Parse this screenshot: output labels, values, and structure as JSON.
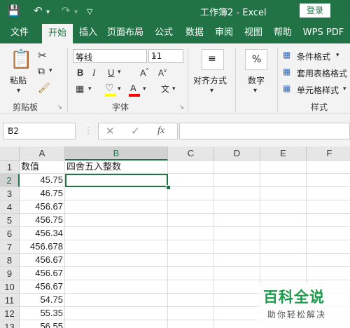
{
  "app": {
    "title": "工作簿2  -  Excel",
    "signin_label": "登录",
    "accent": "#217346"
  },
  "quick_access": {
    "save_icon": "save-icon",
    "undo_icon": "undo-icon",
    "redo_icon": "redo-icon",
    "customize_icon": "customize-icon"
  },
  "tabs": [
    "文件",
    "开始",
    "插入",
    "页面布局",
    "公式",
    "数据",
    "审阅",
    "视图",
    "帮助",
    "WPS PDF"
  ],
  "ribbon": {
    "clipboard": {
      "paste_label": "粘贴",
      "group_label": "剪贴板"
    },
    "font": {
      "font_name": "等线",
      "font_size": "11",
      "group_label": "字体"
    },
    "alignment": {
      "label": "对齐方式"
    },
    "number": {
      "label": "数字",
      "icon_text": "%"
    },
    "styles": {
      "conditional_format": "条件格式",
      "table_format": "套用表格格式",
      "cell_style": "单元格样式",
      "group_label": "样式"
    }
  },
  "formula_bar": {
    "name_box": "B2",
    "fx_label": "fx",
    "formula": ""
  },
  "sheet": {
    "columns": [
      "A",
      "B",
      "C",
      "D",
      "E",
      "F"
    ],
    "selected_col": "B",
    "selected_row": "2",
    "rows": [
      {
        "num": "1",
        "a": "数值",
        "b": "四舍五入整数"
      },
      {
        "num": "2",
        "a": "45.75",
        "b": ""
      },
      {
        "num": "3",
        "a": "46.75",
        "b": ""
      },
      {
        "num": "4",
        "a": "456.67",
        "b": ""
      },
      {
        "num": "5",
        "a": "456.75",
        "b": ""
      },
      {
        "num": "6",
        "a": "456.34",
        "b": ""
      },
      {
        "num": "7",
        "a": "456.678",
        "b": ""
      },
      {
        "num": "8",
        "a": "456.67",
        "b": ""
      },
      {
        "num": "9",
        "a": "456.67",
        "b": ""
      },
      {
        "num": "10",
        "a": "456.67",
        "b": ""
      },
      {
        "num": "11",
        "a": "54.75",
        "b": ""
      },
      {
        "num": "12",
        "a": "55.35",
        "b": ""
      },
      {
        "num": "13",
        "a": "56.55",
        "b": ""
      }
    ]
  },
  "watermark": {
    "title": "百科全说",
    "subtitle": "助你轻松解决"
  }
}
